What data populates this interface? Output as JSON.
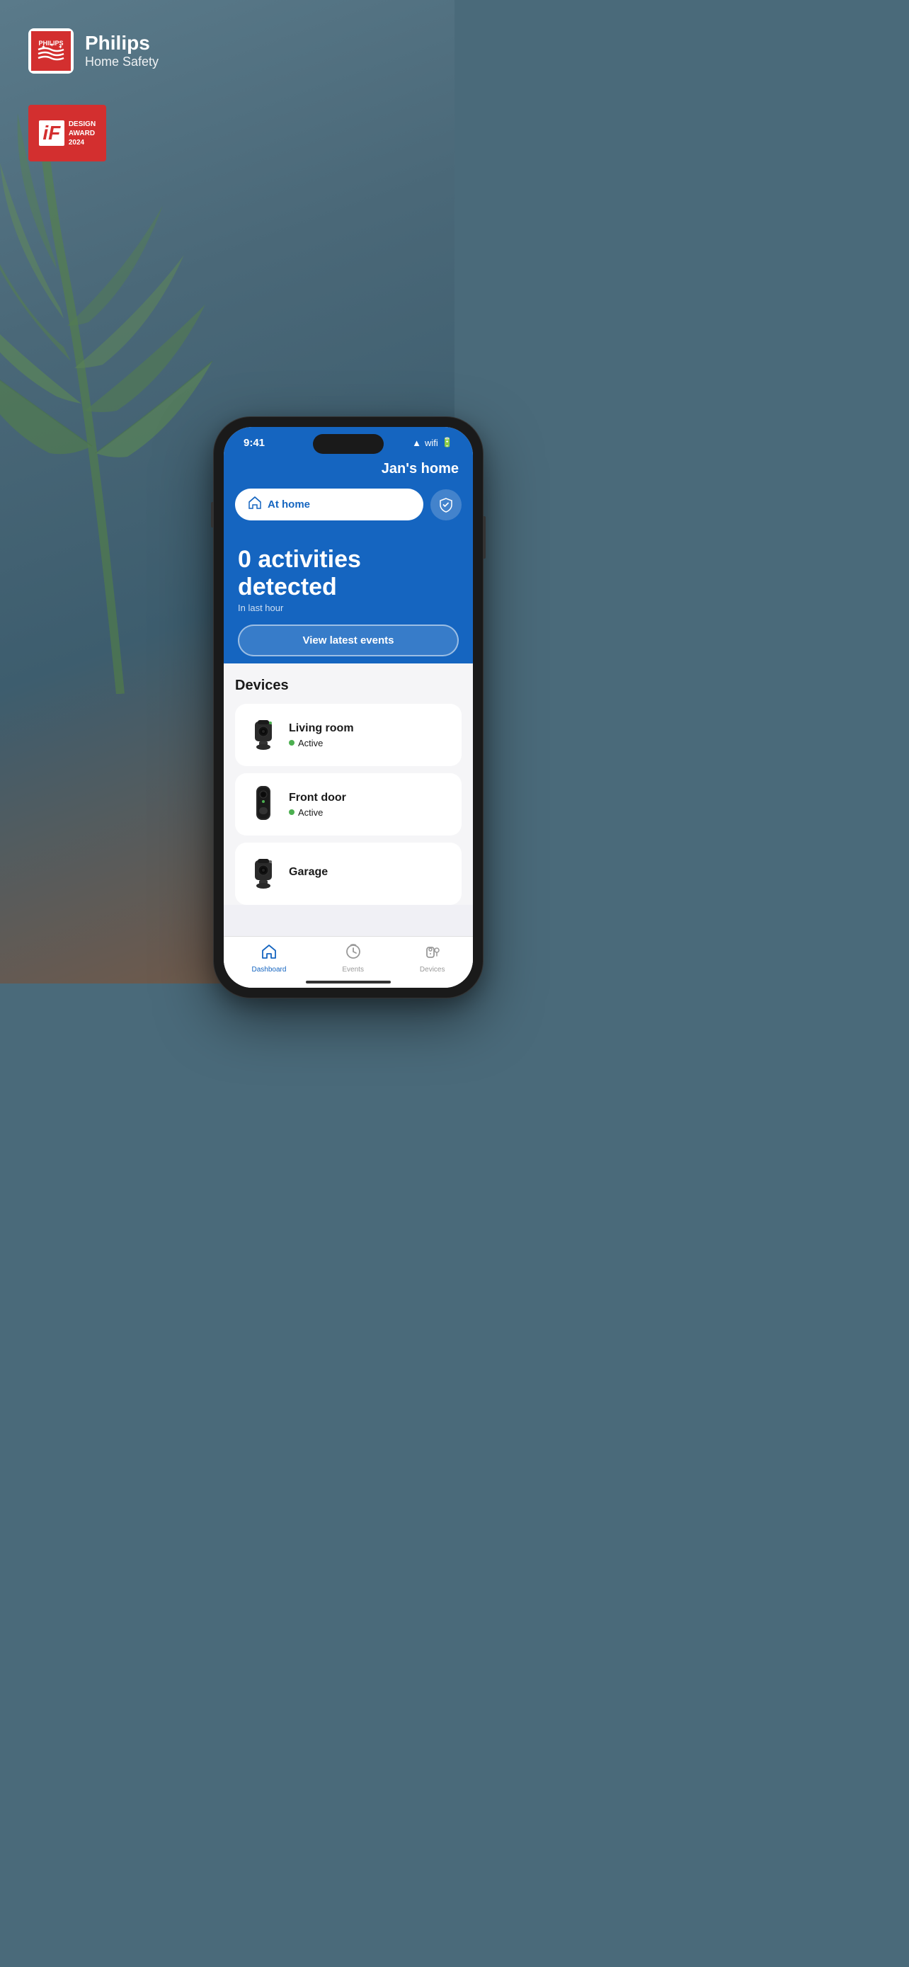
{
  "branding": {
    "name": "Philips",
    "subtitle": "Home Safety"
  },
  "award": {
    "logo": "iF",
    "line1": "DESIGN",
    "line2": "AWARD",
    "year": "2024"
  },
  "phone": {
    "status_bar": {
      "time": "9:41",
      "icons": "●●●"
    },
    "header": {
      "home_name": "Jan's home"
    },
    "mode": {
      "label": "At home",
      "icon": "🏠"
    },
    "activity": {
      "count_text": "0 activities detected",
      "sub_text": "In last hour",
      "view_button": "View latest events"
    },
    "devices_section": {
      "title": "Devices",
      "devices": [
        {
          "name": "Living room",
          "status": "Active",
          "type": "indoor-camera"
        },
        {
          "name": "Front door",
          "status": "Active",
          "type": "doorbell"
        },
        {
          "name": "Garage",
          "status": "",
          "type": "indoor-camera"
        }
      ]
    },
    "tab_bar": {
      "tabs": [
        {
          "label": "Dashboard",
          "icon": "dashboard",
          "active": true
        },
        {
          "label": "Events",
          "icon": "events",
          "active": false
        },
        {
          "label": "Devices",
          "icon": "devices",
          "active": false
        }
      ]
    }
  }
}
